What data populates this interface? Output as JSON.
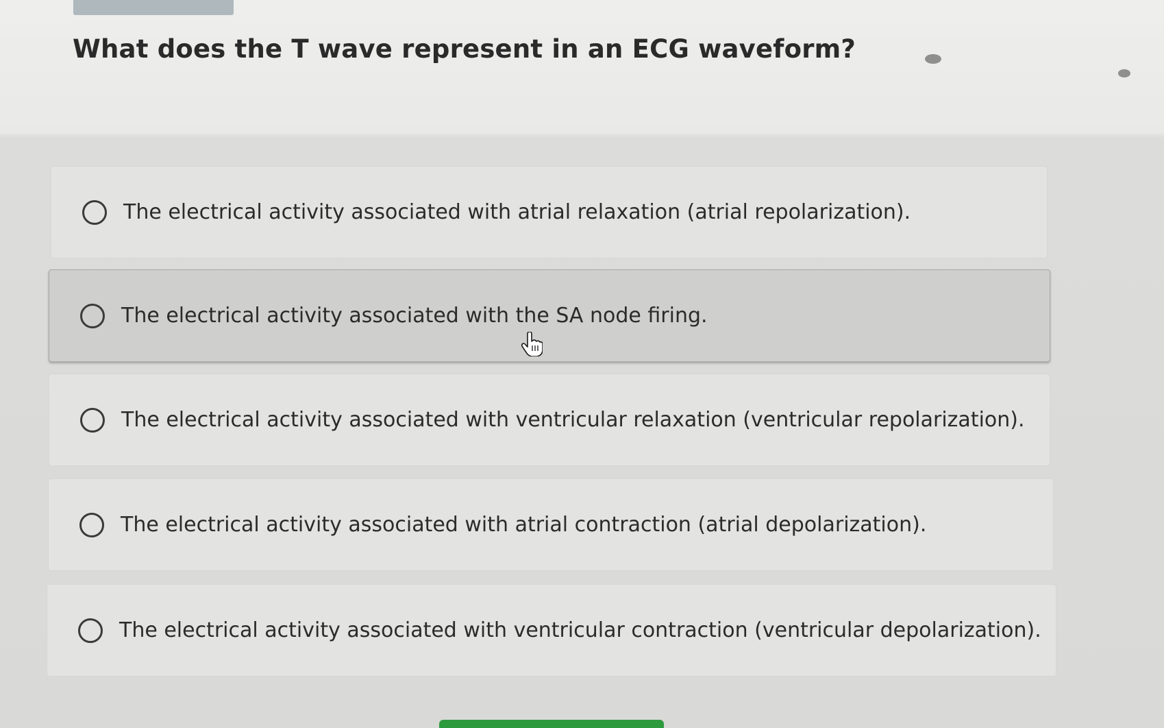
{
  "question": {
    "text": "What does the T wave represent in an ECG waveform?"
  },
  "options": [
    {
      "label": "The electrical activity associated with atrial relaxation (atrial repolarization).",
      "selected": false,
      "hovered": false
    },
    {
      "label": "The electrical activity associated with the SA node firing.",
      "selected": false,
      "hovered": true
    },
    {
      "label": "The electrical activity associated with ventricular relaxation (ventricular repolarization).",
      "selected": false,
      "hovered": false
    },
    {
      "label": "The electrical activity associated with atrial contraction (atrial depolarization).",
      "selected": false,
      "hovered": false
    },
    {
      "label": "The electrical activity associated with ventricular contraction (ventricular depolarization).",
      "selected": false,
      "hovered": false
    }
  ],
  "colors": {
    "submit_button": "#2e9a3e",
    "hover_background": "#cfcfcd"
  },
  "icons": {
    "radio": "radio-unchecked-icon",
    "cursor": "hand-pointer-icon"
  }
}
